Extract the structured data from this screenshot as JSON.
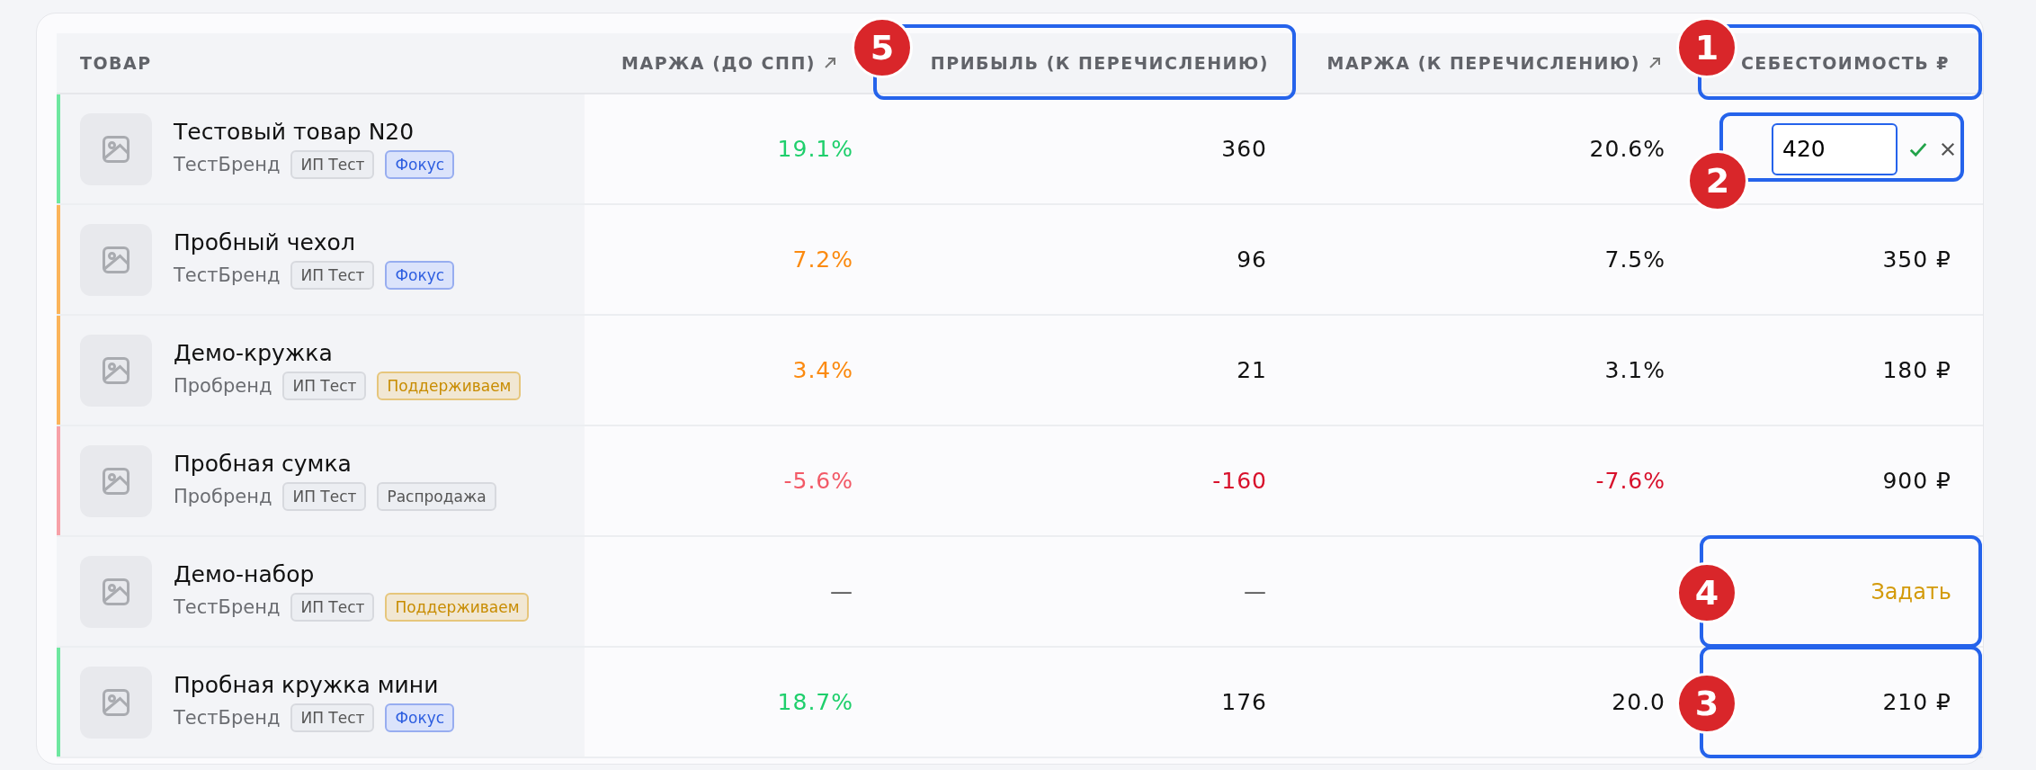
{
  "table": {
    "columns": [
      {
        "label": "ТОВАР"
      },
      {
        "label": "МАРЖА (ДО СПП)",
        "sort_icon": true
      },
      {
        "label": "ПРИБЫЛЬ (К ПЕРЕЧИСЛЕНИЮ)",
        "callout": "5"
      },
      {
        "label": "МАРЖА (К ПЕРЕЧИСЛЕНИЮ)",
        "sort_icon": true
      },
      {
        "label": "СЕБЕСТОИМОСТЬ ₽",
        "callout": "1"
      }
    ],
    "rows": [
      {
        "name": "Тестовый товар N20",
        "brand": "ТестБренд",
        "color": "#6ee7a0",
        "tags": [
          {
            "text": "ИП Тест",
            "kind": "neutral"
          },
          {
            "text": "Фокус",
            "kind": "focus"
          }
        ],
        "margin_before": {
          "text": "19.1%",
          "color": "#1fcf6c"
        },
        "profit": {
          "text": "360",
          "color": "#111111"
        },
        "margin_after": {
          "text": "20.6%",
          "color": "#111111"
        },
        "cost": {
          "kind": "editing",
          "value": "420",
          "callout": "2"
        }
      },
      {
        "name": "Пробный чехол",
        "brand": "ТестБренд",
        "color": "#fbb45a",
        "tags": [
          {
            "text": "ИП Тест",
            "kind": "neutral"
          },
          {
            "text": "Фокус",
            "kind": "focus"
          }
        ],
        "margin_before": {
          "text": "7.2%",
          "color": "#fb8a10"
        },
        "profit": {
          "text": "96",
          "color": "#111111"
        },
        "margin_after": {
          "text": "7.5%",
          "color": "#111111"
        },
        "cost": {
          "kind": "value",
          "text": "350 ₽"
        }
      },
      {
        "name": "Демо-кружка",
        "brand": "Пробренд",
        "color": "#fbb45a",
        "tags": [
          {
            "text": "ИП Тест",
            "kind": "neutral"
          },
          {
            "text": "Поддерживаем",
            "kind": "support"
          }
        ],
        "margin_before": {
          "text": "3.4%",
          "color": "#fb8a10"
        },
        "profit": {
          "text": "21",
          "color": "#111111"
        },
        "margin_after": {
          "text": "3.1%",
          "color": "#111111"
        },
        "cost": {
          "kind": "value",
          "text": "180 ₽"
        }
      },
      {
        "name": "Пробная сумка",
        "brand": "Пробренд",
        "color": "#f7a1a8",
        "tags": [
          {
            "text": "ИП Тест",
            "kind": "neutral"
          },
          {
            "text": "Распродажа",
            "kind": "neutral"
          }
        ],
        "margin_before": {
          "text": "-5.6%",
          "color": "#f25a67"
        },
        "profit": {
          "text": "-160",
          "color": "#d8112c"
        },
        "margin_after": {
          "text": "-7.6%",
          "color": "#d8112c"
        },
        "cost": {
          "kind": "value",
          "text": "900 ₽"
        }
      },
      {
        "name": "Демо-набор",
        "brand": "ТестБренд",
        "tags": [
          {
            "text": "ИП Тест",
            "kind": "neutral"
          },
          {
            "text": "Поддерживаем",
            "kind": "support"
          }
        ],
        "margin_before": {
          "text": "—",
          "color": "#555555"
        },
        "profit": {
          "text": "—",
          "color": "#555555"
        },
        "cost": {
          "kind": "action",
          "text": "Задать",
          "callout": "4"
        }
      },
      {
        "name": "Пробная кружка мини",
        "brand": "ТестБренд",
        "color": "#6ee7a0",
        "tags": [
          {
            "text": "ИП Тест",
            "kind": "neutral"
          },
          {
            "text": "Фокус",
            "kind": "focus"
          }
        ],
        "margin_before": {
          "text": "18.7%",
          "color": "#1fcf6c"
        },
        "profit": {
          "text": "176",
          "color": "#111111"
        },
        "margin_after": {
          "text": "20.0",
          "color": "#111111"
        },
        "cost": {
          "kind": "value",
          "text": "210 ₽",
          "callout": "3"
        }
      }
    ]
  }
}
